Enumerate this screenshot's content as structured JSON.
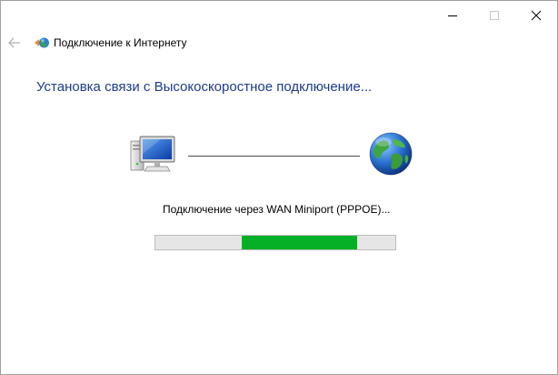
{
  "window": {
    "minimize_icon": "minimize-icon",
    "maximize_icon": "maximize-icon",
    "close_icon": "close-icon"
  },
  "nav": {
    "back_icon": "back-arrow-icon",
    "app_icon": "network-globe-icon",
    "title": "Подключение к Интернету"
  },
  "main": {
    "heading": "Установка связи с Высокоскоростное подключение...",
    "computer_icon": "computer-icon",
    "globe_icon": "globe-icon",
    "status": "Подключение через WAN Miniport (PPPOE)...",
    "progress": {
      "indeterminate": true,
      "segment_start": 0.36,
      "segment_end": 0.84
    }
  },
  "colors": {
    "heading": "#1e3b8c",
    "progress_fill": "#06b025",
    "progress_track": "#e6e6e6"
  }
}
